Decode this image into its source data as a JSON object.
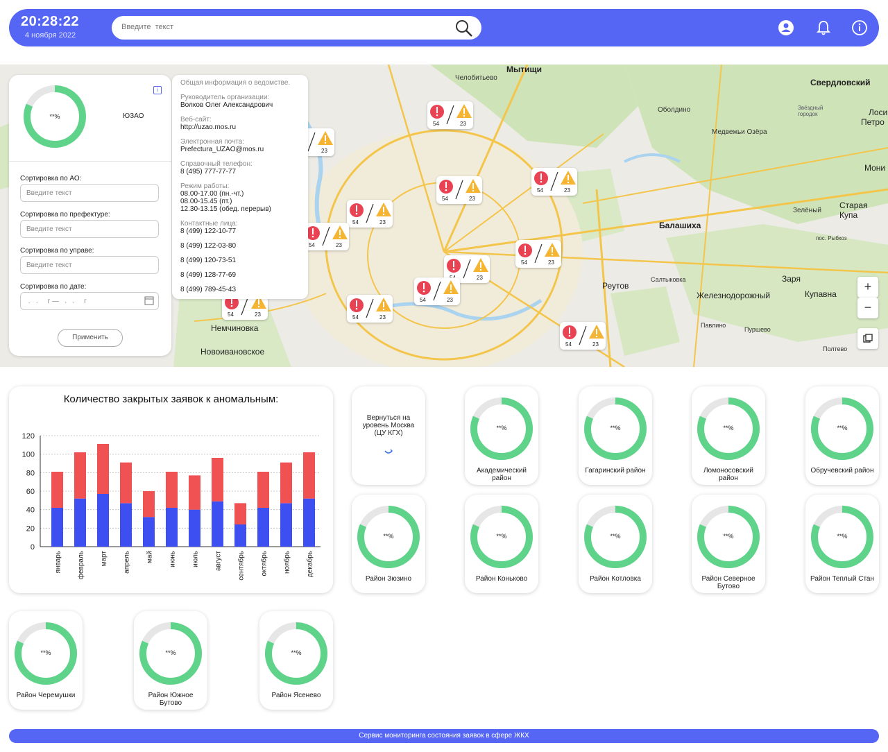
{
  "header": {
    "time": "20:28:22",
    "date": "4 ноября 2022",
    "search_placeholder": "Введите  текст"
  },
  "filters": {
    "gauge_pct": "**%",
    "district": "ЮЗАО",
    "ao_label": "Сортировка по АО:",
    "ao_placeholder": "Введите текст",
    "prefecture_label": "Сортировка по префектуре:",
    "prefecture_placeholder": "Введите текст",
    "uprava_label": "Сортировка по управе:",
    "uprava_placeholder": "Введите текст",
    "date_label": "Сортировка по дате:",
    "date_placeholder": " .   .     г —   .   .     г",
    "apply": "Применить"
  },
  "info": {
    "title": "Общая информация о ведомстве.",
    "head_label": "Руководитель организации:",
    "head_value": "Волков Олег Александрович",
    "site_label": "Веб-сайт:",
    "site_value": "http://uzao.mos.ru",
    "email_label": "Электронная почта:",
    "email_value": "Prefectura_UZAO@mos.ru",
    "phone_label": "Справочный телефон:",
    "phone_value": "8 (495) 777-77-77",
    "hours_label": "Режим работы:",
    "hours_1": "08.00-17.00 (пн.-чт.)",
    "hours_2": "08.00-15.45 (пт.)",
    "hours_3": "12.30-13.15 (обед. перерыв)",
    "contacts_label": "Контактные лица:",
    "contacts": [
      "8 (499) 122-10-77",
      "8 (499) 122-03-80",
      "8 (499) 120-73-51",
      "8 (499) 128-77-69",
      "8 (499) 789-45-43"
    ]
  },
  "map": {
    "zoom_in": "+",
    "zoom_out": "−",
    "marker_red": "54",
    "marker_yellow": "23",
    "labels": {
      "mytishchi": "Мытищи",
      "chelobitevo": "Челобитьево",
      "sverdlovsky": "Свердловский",
      "obolonino": "Оболдино",
      "zvezdny": "Звёздный городок",
      "medvezhi": "Медвежьи Озёра",
      "balashikha": "Балашиха",
      "zeleny": "Зелёный",
      "staraya": "Старая Купа",
      "rybkhoz": "пос. Рыбхоз",
      "reutov": "Реутов",
      "saltykovka": "Салтыковка",
      "zarya": "Заря",
      "zheleznodorozhny": "Железнодорожный",
      "kupavna": "Купавна",
      "pavlino": "Павлино",
      "purshevo": "Пуршево",
      "poltevo": "Полтево",
      "nemchinovka": "Немчиновка",
      "novoivanovskoe": "Новоивановское",
      "moni": "Мони",
      "losi": "Лоси",
      "petro": "Петро"
    }
  },
  "chart_data": {
    "type": "bar",
    "title": "Количество закрытых заявок к аномальным:",
    "categories": [
      "январь",
      "февраль",
      "март",
      "апрель",
      "май",
      "июнь",
      "июль",
      "август",
      "сентябрь",
      "октябрь",
      "ноябрь",
      "декабрь"
    ],
    "series": [
      {
        "color": "#3d4ff0",
        "values": [
          42,
          52,
          57,
          47,
          32,
          42,
          40,
          49,
          24,
          42,
          47,
          52
        ]
      },
      {
        "color": "#f05152",
        "values": [
          39,
          50,
          54,
          44,
          28,
          39,
          37,
          47,
          23,
          39,
          44,
          50
        ]
      }
    ],
    "stacked": true,
    "ylim": [
      0,
      120
    ],
    "yticks": [
      0,
      20,
      40,
      60,
      80,
      100,
      120
    ],
    "grid": true
  },
  "back": {
    "text": "Вернуться на уровень Москва (ЦУ КГХ)"
  },
  "districts": [
    {
      "name": "Академический район",
      "pct": "**%"
    },
    {
      "name": "Гагаринский район",
      "pct": "**%"
    },
    {
      "name": "Ломоносовский район",
      "pct": "**%"
    },
    {
      "name": "Обручевский район",
      "pct": "**%"
    },
    {
      "name": "Район Зюзино",
      "pct": "**%"
    },
    {
      "name": "Район Коньково",
      "pct": "**%"
    },
    {
      "name": "Район Котловка",
      "pct": "**%"
    },
    {
      "name": "Район Северное Бутово",
      "pct": "**%"
    },
    {
      "name": "Район Теплый Стан",
      "pct": "**%"
    },
    {
      "name": "Район Черемушки",
      "pct": "**%"
    },
    {
      "name": "Район Южное Бутово",
      "pct": "**%"
    },
    {
      "name": "Район Ясенево",
      "pct": "**%"
    }
  ],
  "footer": {
    "text": "Сервис мониторинга состояния заявок в сфере ЖКХ"
  },
  "colors": {
    "accent": "#5566f5",
    "gauge": "#5ed389",
    "gauge_track": "#e6e6e6"
  }
}
